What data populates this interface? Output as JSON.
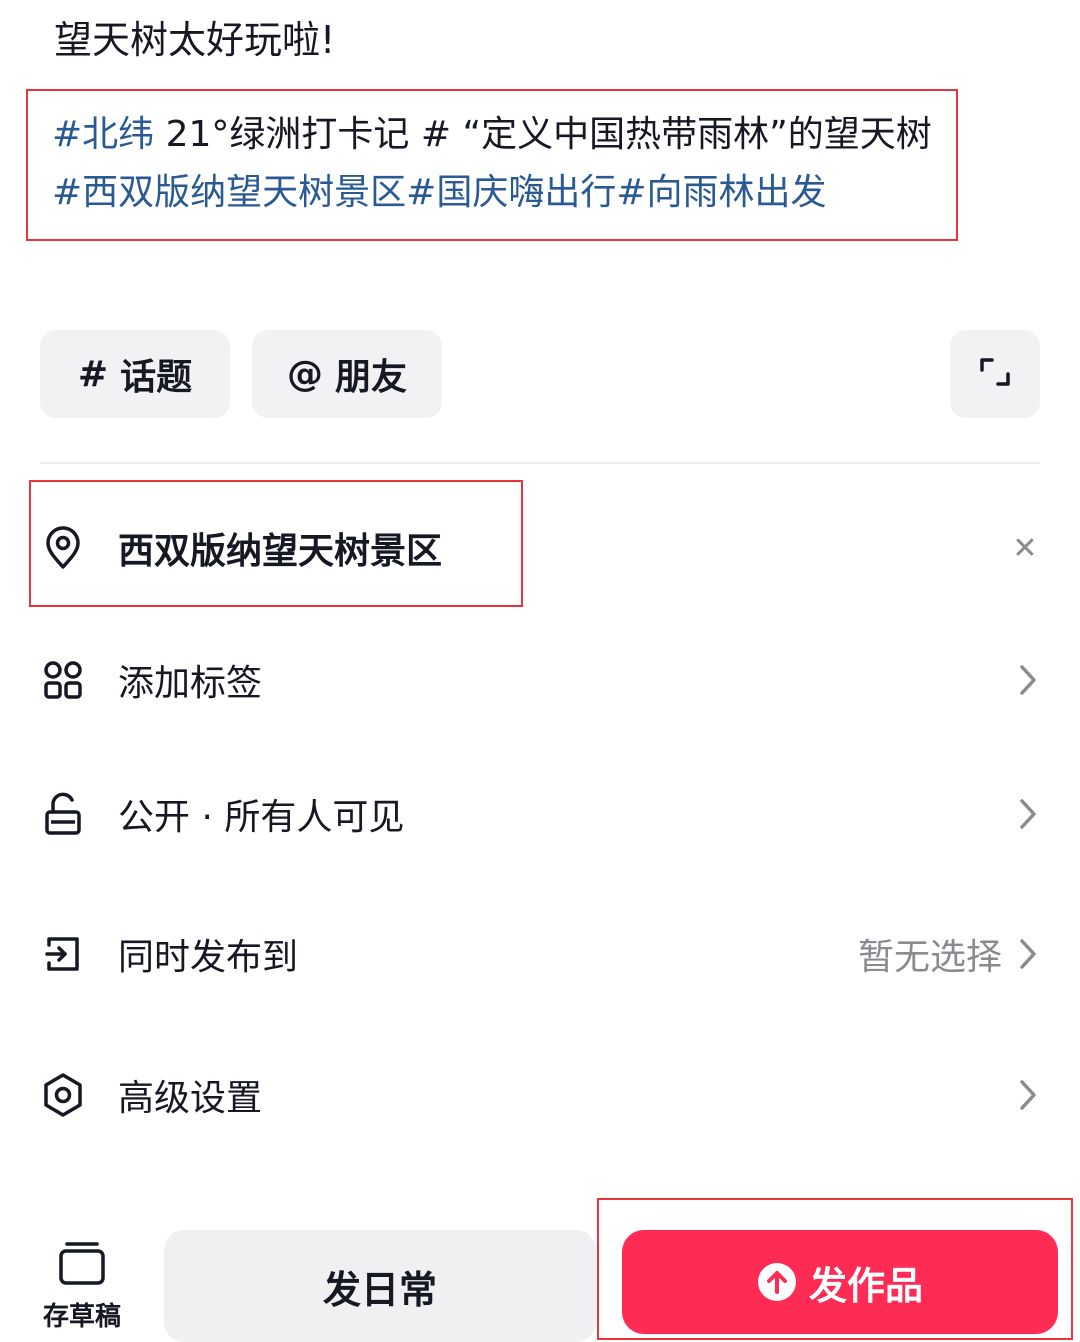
{
  "post": {
    "title": "望天树太好玩啦!"
  },
  "description": {
    "segments": [
      {
        "text": "#北纬",
        "kind": "tag"
      },
      {
        "text": " 21°绿洲打卡记 # “定义中国热带雨林”的望天树",
        "kind": "plain"
      },
      {
        "text": "#西双版纳望天树景区#国庆嗨出行#向雨林出发",
        "kind": "tag"
      }
    ]
  },
  "chips": {
    "topic": {
      "symbol": "#",
      "label": "话题"
    },
    "friend": {
      "symbol": "@",
      "label": "朋友"
    }
  },
  "location": {
    "label": "西双版纳望天树景区",
    "clear_symbol": "✕"
  },
  "rows": {
    "tags": {
      "label": "添加标签"
    },
    "visibility": {
      "label": "公开 · 所有人可见"
    },
    "sync": {
      "label": "同时发布到",
      "value": "暂无选择"
    },
    "advanced": {
      "label": "高级设置"
    }
  },
  "bottom": {
    "draft_label": "存草稿",
    "daily_label": "发日常",
    "publish_label": "发作品"
  },
  "colors": {
    "accent": "#fe2c55",
    "hashtag": "#2a5a93",
    "annotation_box": "#e8343c"
  },
  "icons": [
    "location-pin-icon",
    "grid-tags-icon",
    "unlock-icon",
    "share-out-icon",
    "hexagon-settings-icon",
    "chevron-right-icon",
    "expand-icon",
    "draft-box-icon",
    "upload-arrow-icon",
    "close-icon"
  ]
}
